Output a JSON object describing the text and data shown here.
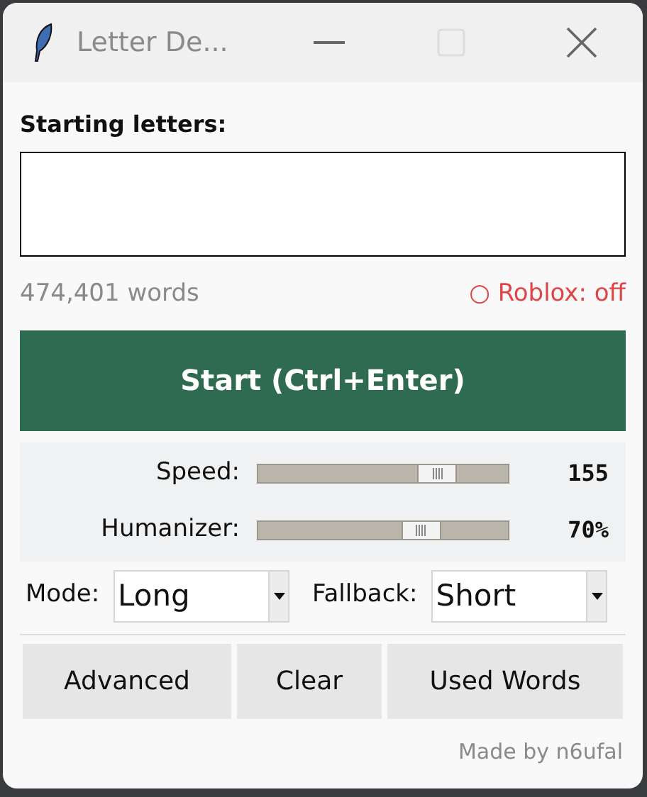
{
  "window": {
    "title": "Letter De..."
  },
  "input": {
    "label": "Starting letters:"
  },
  "word_count": "474,401 words",
  "roblox": {
    "symbol": "○",
    "label": "Roblox: off",
    "on": false
  },
  "start_button": "Start (Ctrl+Enter)",
  "sliders": [
    {
      "label": "Speed:",
      "level": 0.76,
      "reading": "155"
    },
    {
      "label": "Humanizer:",
      "level": 0.68,
      "reading": "70%"
    }
  ],
  "dropdowns": [
    {
      "label": "Mode:",
      "value": "Long"
    },
    {
      "label": "Fallback:",
      "value": "Short"
    }
  ],
  "buttons": [
    "Advanced",
    "Clear",
    "Used Words"
  ],
  "footer": "Made by n6ufal"
}
